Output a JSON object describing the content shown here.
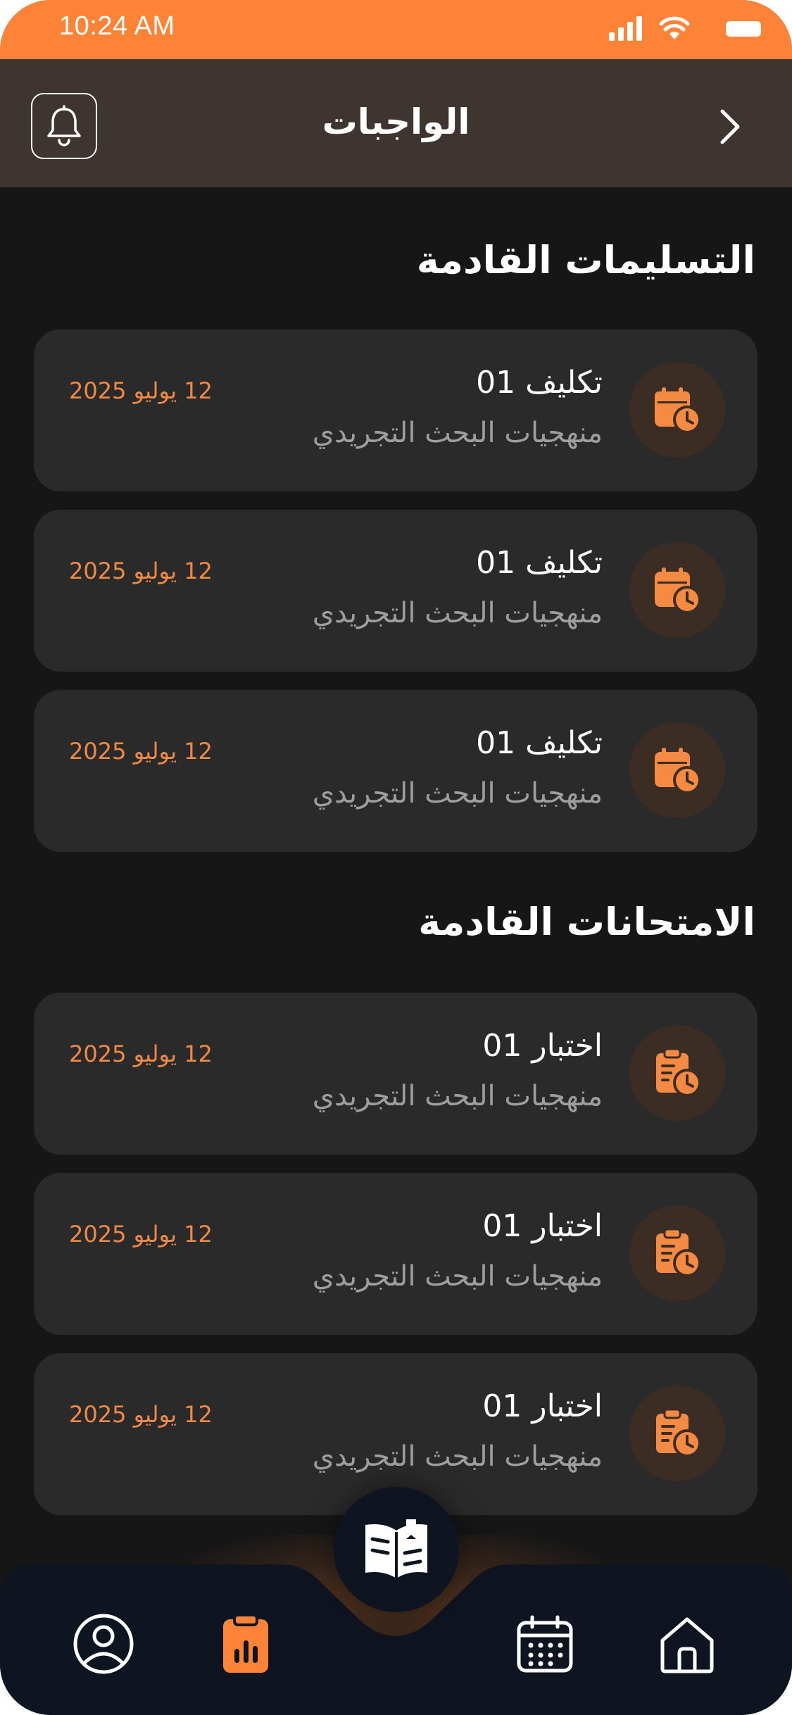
{
  "status_bar": {
    "time": "10:24 AM"
  },
  "header": {
    "title": "الواجبات"
  },
  "colors": {
    "accent": "#fd8437",
    "header_bg": "#3e3430",
    "background": "#161616",
    "card_bg": "#2a2a2a",
    "nav_bg": "#0e1420"
  },
  "sections": [
    {
      "title": "التسليمات القادمة",
      "icon": "calendar-clock-icon",
      "items": [
        {
          "title": "تكليف 01",
          "subtitle": "منهجيات البحث التجريدي",
          "date": "12 يوليو 2025"
        },
        {
          "title": "تكليف 01",
          "subtitle": "منهجيات البحث التجريدي",
          "date": "12 يوليو 2025"
        },
        {
          "title": "تكليف 01",
          "subtitle": "منهجيات البحث التجريدي",
          "date": "12 يوليو 2025"
        }
      ]
    },
    {
      "title": "الامتحانات القادمة",
      "icon": "clipboard-clock-icon",
      "items": [
        {
          "title": "اختبار 01",
          "subtitle": "منهجيات البحث التجريدي",
          "date": "12 يوليو 2025"
        },
        {
          "title": "اختبار 01",
          "subtitle": "منهجيات البحث التجريدي",
          "date": "12 يوليو 2025"
        },
        {
          "title": "اختبار 01",
          "subtitle": "منهجيات البحث التجريدي",
          "date": "12 يوليو 2025"
        }
      ]
    }
  ],
  "bottom_nav": {
    "items": [
      {
        "icon": "profile-icon",
        "active": false
      },
      {
        "icon": "clipboard-chart-icon",
        "active": true
      },
      {
        "icon": "open-book-icon",
        "active": false
      },
      {
        "icon": "calendar-icon",
        "active": false
      },
      {
        "icon": "home-icon",
        "active": false
      }
    ]
  }
}
